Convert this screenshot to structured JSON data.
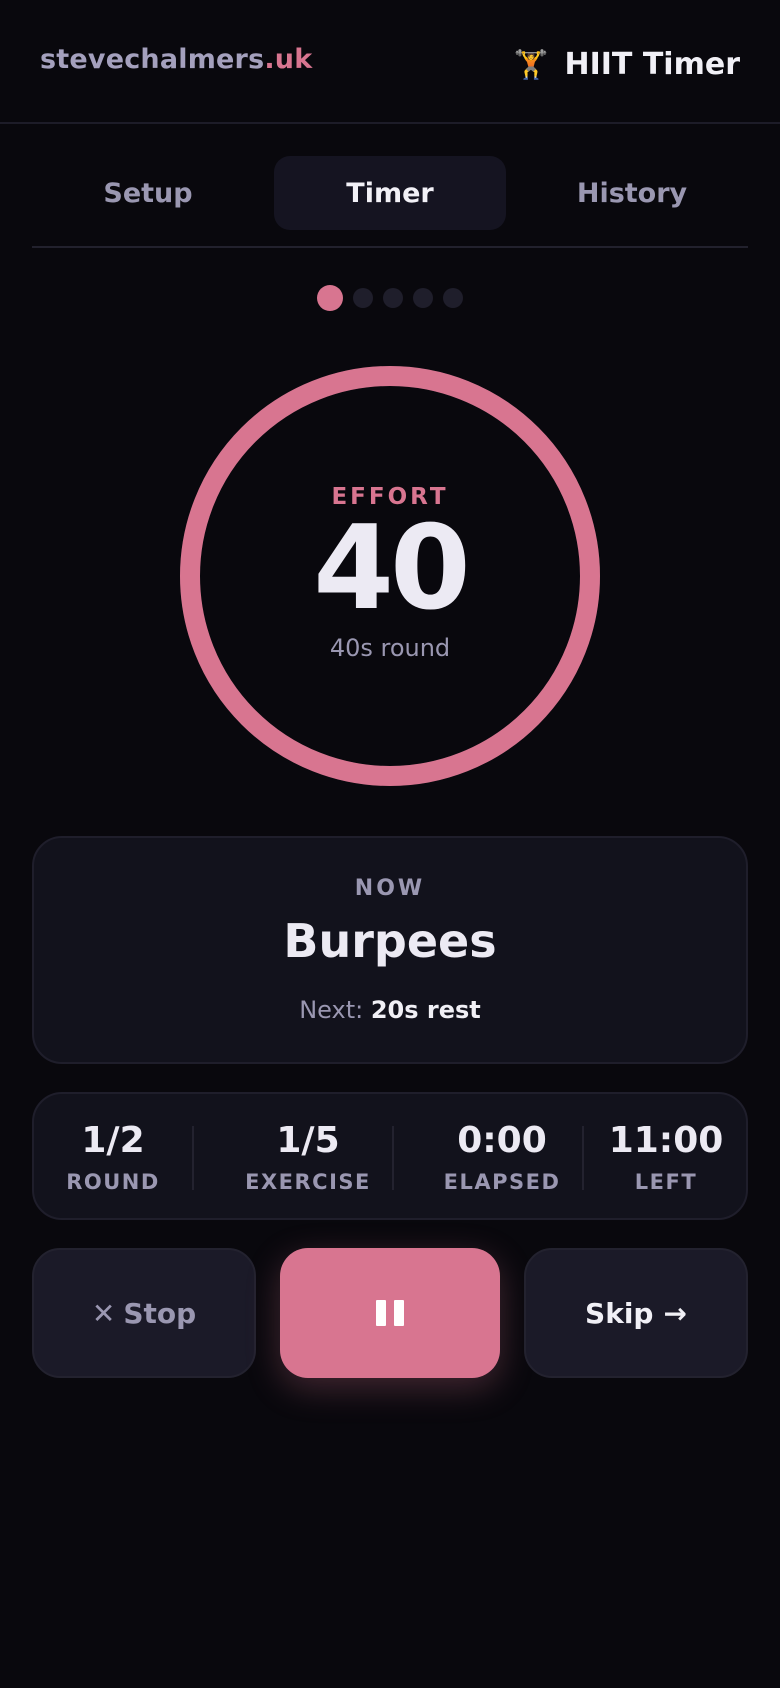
{
  "header": {
    "brand_name": "stevechalmers",
    "brand_tld": ".uk",
    "app_icon": "🏋️",
    "app_title": "HIIT Timer"
  },
  "tabs": [
    {
      "label": "Setup",
      "active": false
    },
    {
      "label": "Timer",
      "active": true
    },
    {
      "label": "History",
      "active": false
    }
  ],
  "progress_dots": {
    "total": 5,
    "current": 1
  },
  "timer": {
    "phase": "EFFORT",
    "remaining": "40",
    "round_info": "40s round",
    "progress": 1.0,
    "accent": "#d87590"
  },
  "now_card": {
    "label": "NOW",
    "exercise": "Burpees",
    "next_prefix": "Next:",
    "next_value": "20s rest"
  },
  "stats": [
    {
      "value": "1/2",
      "label": "ROUND"
    },
    {
      "value": "1/5",
      "label": "EXERCISE"
    },
    {
      "value": "0:00",
      "label": "ELAPSED"
    },
    {
      "value": "11:00",
      "label": "LEFT"
    }
  ],
  "controls": {
    "stop_icon": "✕",
    "stop_label": "Stop",
    "pause_icon": "pause-icon",
    "skip_label": "Skip",
    "skip_icon": "→"
  }
}
